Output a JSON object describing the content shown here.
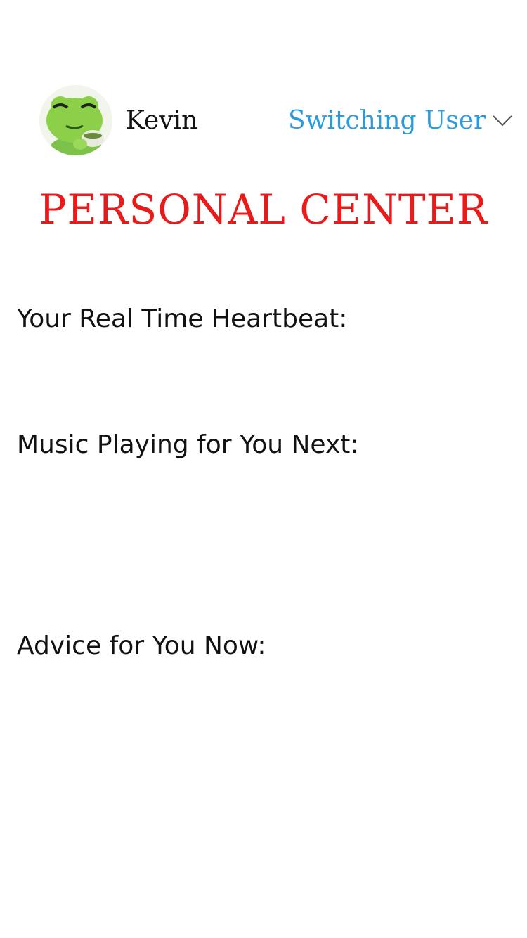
{
  "header": {
    "avatar_icon": "frog-avatar-icon",
    "username": "Kevin",
    "switch_user_label": "Switching User",
    "switch_user_icon": "chevron-down-icon"
  },
  "title": "PERSONAL CENTER",
  "sections": {
    "heartbeat_label": "Your Real Time Heartbeat:",
    "music_label": "Music Playing for You Next:",
    "advice_label": "Advice for You Now:"
  },
  "colors": {
    "title_red": "#e81a1a",
    "link_blue": "#2b9be0",
    "text_dark": "#111111",
    "frog_green": "#8cd04a"
  }
}
